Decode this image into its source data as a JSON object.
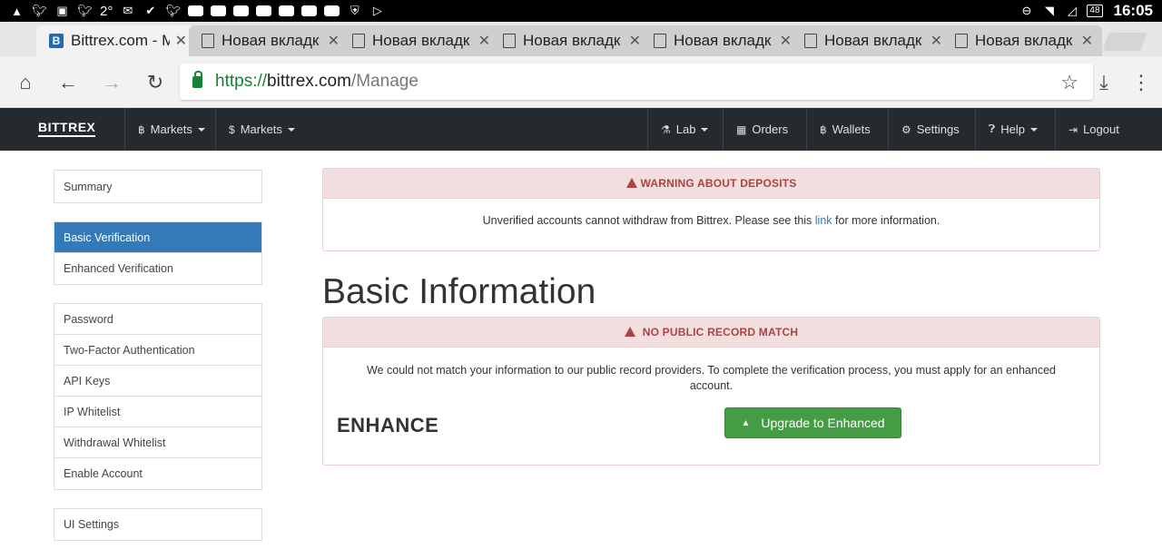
{
  "status_bar": {
    "temperature": "2°",
    "battery": "48",
    "time": "16:05"
  },
  "browser": {
    "tabs": [
      {
        "title": "Bittrex.com - M",
        "active": true
      },
      {
        "title": "Новая вкладк",
        "active": false
      },
      {
        "title": "Новая вкладк",
        "active": false
      },
      {
        "title": "Новая вкладк",
        "active": false
      },
      {
        "title": "Новая вкладк",
        "active": false
      },
      {
        "title": "Новая вкладк",
        "active": false
      },
      {
        "title": "Новая вкладк",
        "active": false
      }
    ],
    "url": {
      "scheme": "https://",
      "host": "bittrex.com",
      "path": "/Manage"
    }
  },
  "navbar": {
    "brand": "BITTREX",
    "left": [
      {
        "icon": "bitcoin-icon",
        "label": "Markets"
      },
      {
        "icon": "dollar-icon",
        "label": "Markets"
      }
    ],
    "right": [
      {
        "icon": "flask-icon",
        "label": "Lab"
      },
      {
        "icon": "calendar-icon",
        "label": "Orders"
      },
      {
        "icon": "bitcoin-icon",
        "label": "Wallets"
      },
      {
        "icon": "gear-icon",
        "label": "Settings"
      },
      {
        "icon": "question-icon",
        "label": "Help"
      },
      {
        "icon": "logout-icon",
        "label": "Logout"
      }
    ]
  },
  "sidebar": {
    "groups": [
      {
        "items": [
          {
            "label": "Summary",
            "active": false
          }
        ]
      },
      {
        "items": [
          {
            "label": "Basic Verification",
            "active": true
          },
          {
            "label": "Enhanced Verification",
            "active": false
          }
        ]
      },
      {
        "items": [
          {
            "label": "Password",
            "active": false
          },
          {
            "label": "Two-Factor Authentication",
            "active": false
          },
          {
            "label": "API Keys",
            "active": false
          },
          {
            "label": "IP Whitelist",
            "active": false
          },
          {
            "label": "Withdrawal Whitelist",
            "active": false
          },
          {
            "label": "Enable Account",
            "active": false
          }
        ]
      },
      {
        "items": [
          {
            "label": "UI Settings",
            "active": false
          }
        ]
      }
    ]
  },
  "deposit_warning": {
    "heading": "WARNING ABOUT DEPOSITS",
    "text_before": "Unverified accounts cannot withdraw from Bittrex. Please see this ",
    "link": "link",
    "text_after": " for more information."
  },
  "main": {
    "title": "Basic Information"
  },
  "record_panel": {
    "heading": "NO PUBLIC RECORD MATCH",
    "message": "We could not match your information to our public record providers. To complete the verification process, you must apply for an enhanced account.",
    "enhance_label": "ENHANCE",
    "upgrade_button": "Upgrade to Enhanced"
  },
  "colors": {
    "navbar_bg": "#252a2e",
    "active_blue": "#337ab7",
    "danger_text": "#a94442",
    "success_green": "#449d44"
  }
}
